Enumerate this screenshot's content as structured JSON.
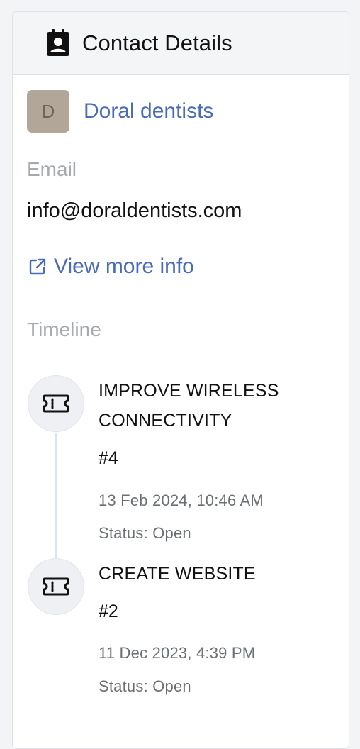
{
  "header": {
    "title": "Contact Details",
    "icon": "contact-card-icon"
  },
  "contact": {
    "avatar_initial": "D",
    "name": "Doral dentists",
    "email_label": "Email",
    "email": "info@doraldentists.com",
    "view_more_label": "View more info"
  },
  "timeline": {
    "label": "Timeline",
    "items": [
      {
        "title_line1": "IMPROVE WIRELESS",
        "title_line2": "CONNECTIVITY",
        "number": "#4",
        "date": "13 Feb 2024, 10:46 AM",
        "status": "Status: Open",
        "icon": "ticket-icon"
      },
      {
        "title_line1": "CREATE WEBSITE",
        "number": "#2",
        "date": "11 Dec 2023, 4:39 PM",
        "status": "Status: Open",
        "icon": "ticket-icon"
      }
    ]
  },
  "colors": {
    "link": "#4a6cb7",
    "avatar_bg": "#b2a698",
    "muted_label": "#a6a9ad"
  }
}
